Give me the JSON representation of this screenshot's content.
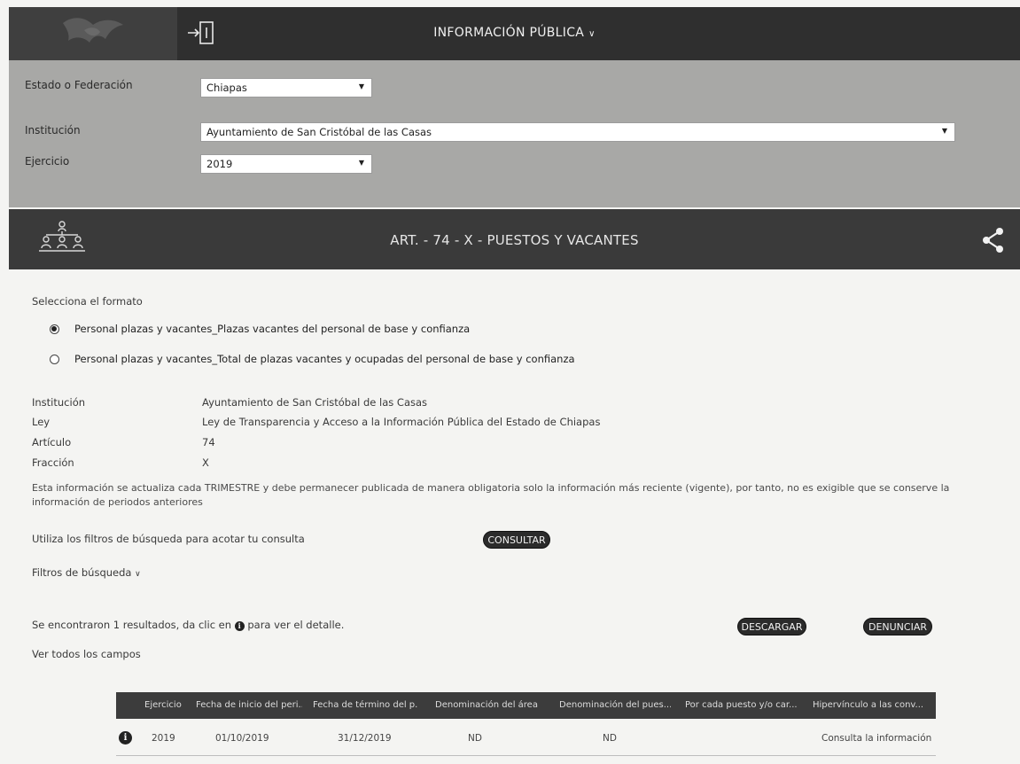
{
  "header": {
    "title": "INFORMACIÓN PÚBLICA"
  },
  "filters": {
    "estado": {
      "label": "Estado o Federación",
      "value": "Chiapas"
    },
    "institucion": {
      "label": "Institución",
      "value": "Ayuntamiento de San Cristóbal de las Casas"
    },
    "ejercicio": {
      "label": "Ejercicio",
      "value": "2019"
    }
  },
  "banner": {
    "title": "ART. - 74 - X - PUESTOS Y VACANTES"
  },
  "format": {
    "prompt": "Selecciona el formato",
    "options": [
      {
        "label": "Personal plazas y vacantes_Plazas vacantes del personal de base y confianza",
        "selected": true
      },
      {
        "label": "Personal plazas y vacantes_Total de plazas vacantes y ocupadas del personal de base y confianza",
        "selected": false
      }
    ]
  },
  "info": {
    "institucion_label": "Institución",
    "institucion_value": "Ayuntamiento de San Cristóbal de las Casas",
    "ley_label": "Ley",
    "ley_value": "Ley de Transparencia y Acceso a la Información Pública del Estado de Chiapas",
    "articulo_label": "Artículo",
    "articulo_value": "74",
    "fraccion_label": "Fracción",
    "fraccion_value": "X",
    "note": "Esta información se actualiza cada TRIMESTRE y debe permanecer publicada de manera obligatoria solo la información más reciente (vigente), por tanto, no es exigible que se conserve la información de periodos anteriores"
  },
  "search": {
    "hint": "Utiliza los filtros de búsqueda para acotar tu consulta",
    "consultar_label": "CONSULTAR",
    "filters_toggle": "Filtros de búsqueda"
  },
  "results": {
    "summary_prefix": "Se encontraron 1 resultados, da clic en",
    "summary_suffix": "para ver el detalle.",
    "descargar_label": "DESCARGAR",
    "denunciar_label": "DENUNCIAR",
    "ver_todos": "Ver todos los campos"
  },
  "table": {
    "columns": [
      "Ejercicio",
      "Fecha de inicio del peri...",
      "Fecha de término del p...",
      "Denominación del área",
      "Denominación del pues...",
      "Por cada puesto y/o car...",
      "Hipervínculo a las conv..."
    ],
    "rows": [
      {
        "ejercicio": "2019",
        "fecha_inicio": "01/10/2019",
        "fecha_termino": "31/12/2019",
        "area": "ND",
        "puesto": "ND",
        "hipervinculo": "Consulta la información"
      }
    ]
  }
}
